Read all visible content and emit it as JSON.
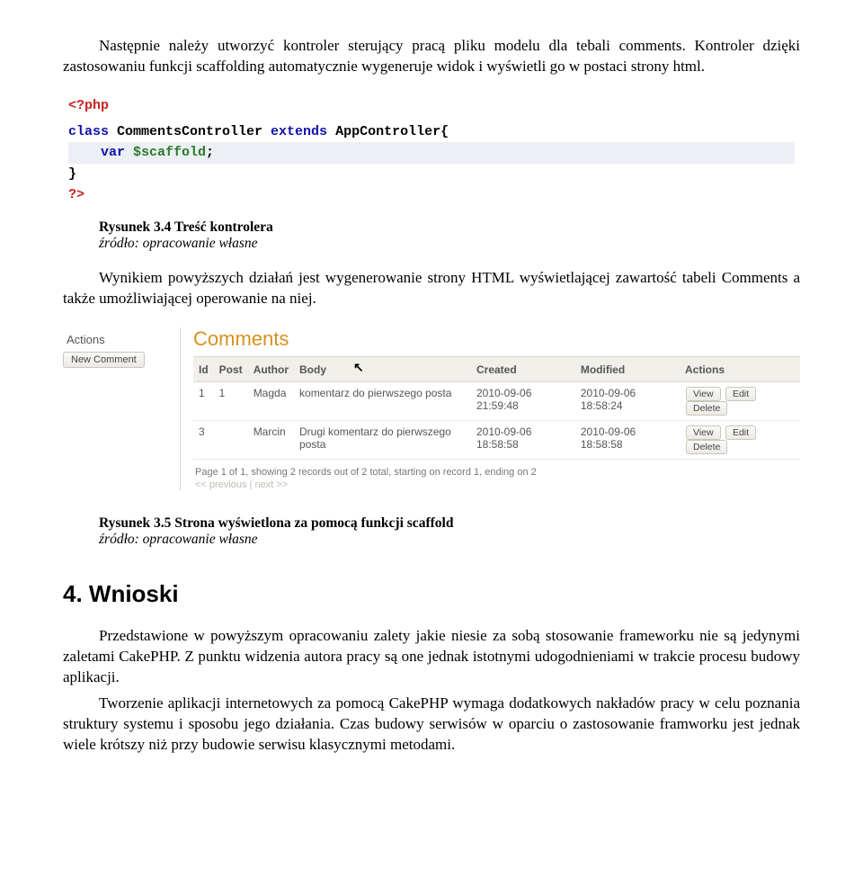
{
  "intro_para": "Następnie należy utworzyć kontroler sterujący pracą pliku modelu dla tebali comments. Kontroler dzięki zastosowaniu funkcji scaffolding automatycznie wygeneruje widok i wyświetli go w postaci strony html.",
  "code": {
    "l1": "<?php",
    "l2_kw": "class ",
    "l2_name": "CommentsController ",
    "l2_ext": "extends ",
    "l2_app": "AppController{",
    "l3_kw": "var ",
    "l3_var": "$scaffold",
    "l3_semi": ";",
    "l4": "}",
    "l5": "?>"
  },
  "fig34": {
    "title": "Rysunek 3.4 Treść kontrolera",
    "src": "źródło: opracowanie własne"
  },
  "post34_para": "Wynikiem powyższych działań jest wygenerowanie strony HTML wyświetlającej zawartość tabeli Comments a także umożliwiającej operowanie na niej.",
  "scaffold": {
    "sidebar_title": "Actions",
    "new_btn": "New Comment",
    "panel_title": "Comments",
    "headers": [
      "Id",
      "Post",
      "Author",
      "Body",
      "Created",
      "Modified",
      "Actions"
    ],
    "row_btns": [
      "View",
      "Edit",
      "Delete"
    ],
    "rows": [
      {
        "id": "1",
        "post": "1",
        "author": "Magda",
        "body": "komentarz do pierwszego posta",
        "created": "2010-09-06 21:59:48",
        "modified": "2010-09-06 18:58:24"
      },
      {
        "id": "3",
        "post": "",
        "author": "Marcin",
        "body": "Drugi komentarz do pierwszego posta",
        "created": "2010-09-06 18:58:58",
        "modified": "2010-09-06 18:58:58"
      }
    ],
    "pager": "Page 1 of 1, showing 2 records out of 2 total, starting on record 1, ending on 2",
    "pager_links": "<< previous | next >>"
  },
  "fig35": {
    "title": "Rysunek 3.5 Strona wyświetlona za pomocą funkcji scaffold",
    "src": "źródło: opracowanie własne"
  },
  "section_heading": "4. Wnioski",
  "wnioski_para1": "Przedstawione w powyższym opracowaniu zalety jakie niesie za sobą stosowanie frameworku nie są jedynymi zaletami CakePHP. Z punktu widzenia autora pracy są one jednak istotnymi udogodnieniami w trakcie procesu budowy aplikacji.",
  "wnioski_para2": "Tworzenie aplikacji internetowych za pomocą CakePHP wymaga dodatkowych nakładów pracy w celu poznania struktury systemu i sposobu jego działania. Czas budowy serwisów w oparciu o zastosowanie framworku jest jednak wiele krótszy niż przy budowie serwisu klasycznymi metodami."
}
